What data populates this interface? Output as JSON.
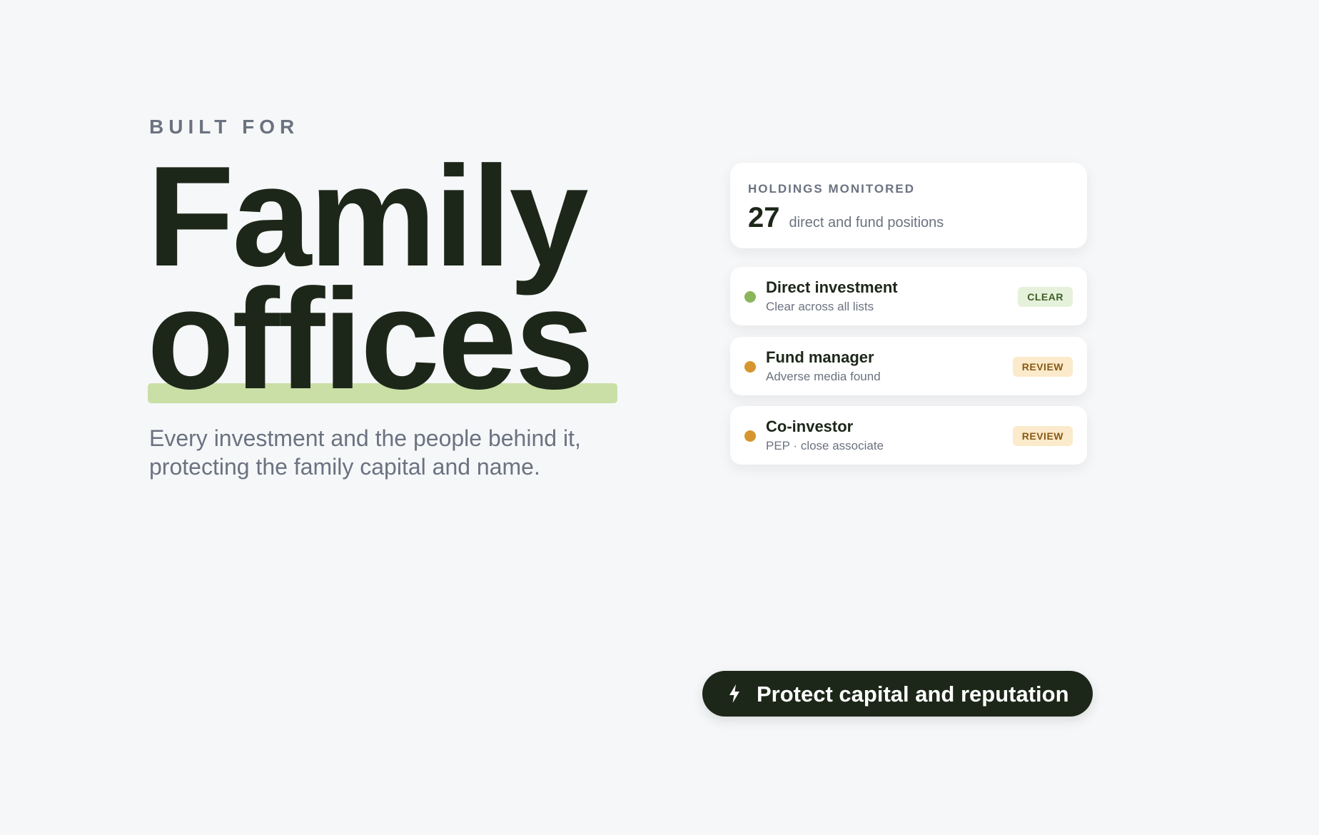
{
  "hero": {
    "eyebrow": "BUILT FOR",
    "headline_line1": "Family",
    "headline_line2": "offices",
    "subtitle": "Every investment and the people behind it, protecting the family capital and name."
  },
  "summary": {
    "label": "HOLDINGS MONITORED",
    "count": "27",
    "description": "direct and fund positions"
  },
  "entities": [
    {
      "name": "Direct investment",
      "detail": "Clear across all lists",
      "status": "CLEAR",
      "status_color": "#8ab55b",
      "badge_bg": "#e6f1dc",
      "badge_text": "#3e5f26"
    },
    {
      "name": "Fund manager",
      "detail": "Adverse media found",
      "status": "REVIEW",
      "status_color": "#d6962f",
      "badge_bg": "#fbeacb",
      "badge_text": "#8a5a13"
    },
    {
      "name": "Co-investor",
      "detail": "PEP · close associate",
      "status": "REVIEW",
      "status_color": "#d6962f",
      "badge_bg": "#fbeacb",
      "badge_text": "#8a5a13"
    }
  ],
  "cta": {
    "label": "Protect capital and reputation",
    "icon": "lightning-bolt-icon"
  },
  "colors": {
    "background": "#f6f7f9",
    "ink": "#1d2719",
    "muted": "#6b7280",
    "highlight": "#c9dfa6"
  }
}
